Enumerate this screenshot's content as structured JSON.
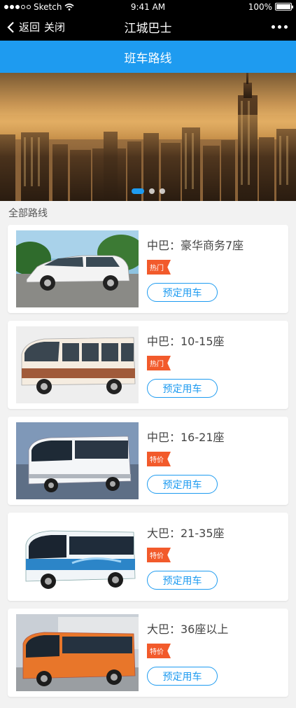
{
  "status_bar": {
    "carrier": "Sketch",
    "time": "9:41 AM",
    "battery": "100%",
    "battery_level": 1.0
  },
  "nav": {
    "back_label": "返回",
    "close_label": "关闭",
    "title": "江城巴士"
  },
  "page_title": "班车路线",
  "banner": {
    "slide_count": 3,
    "active_index": 0
  },
  "section_label": "全部路线",
  "routes": [
    {
      "name": "中巴：豪华商务7座",
      "tag": "热门",
      "button": "预定用车"
    },
    {
      "name": "中巴：10-15座",
      "tag": "热门",
      "button": "预定用车"
    },
    {
      "name": "中巴：16-21座",
      "tag": "特价",
      "button": "预定用车"
    },
    {
      "name": "大巴：21-35座",
      "tag": "特价",
      "button": "预定用车"
    },
    {
      "name": "大巴：36座以上",
      "tag": "特价",
      "button": "预定用车"
    }
  ]
}
